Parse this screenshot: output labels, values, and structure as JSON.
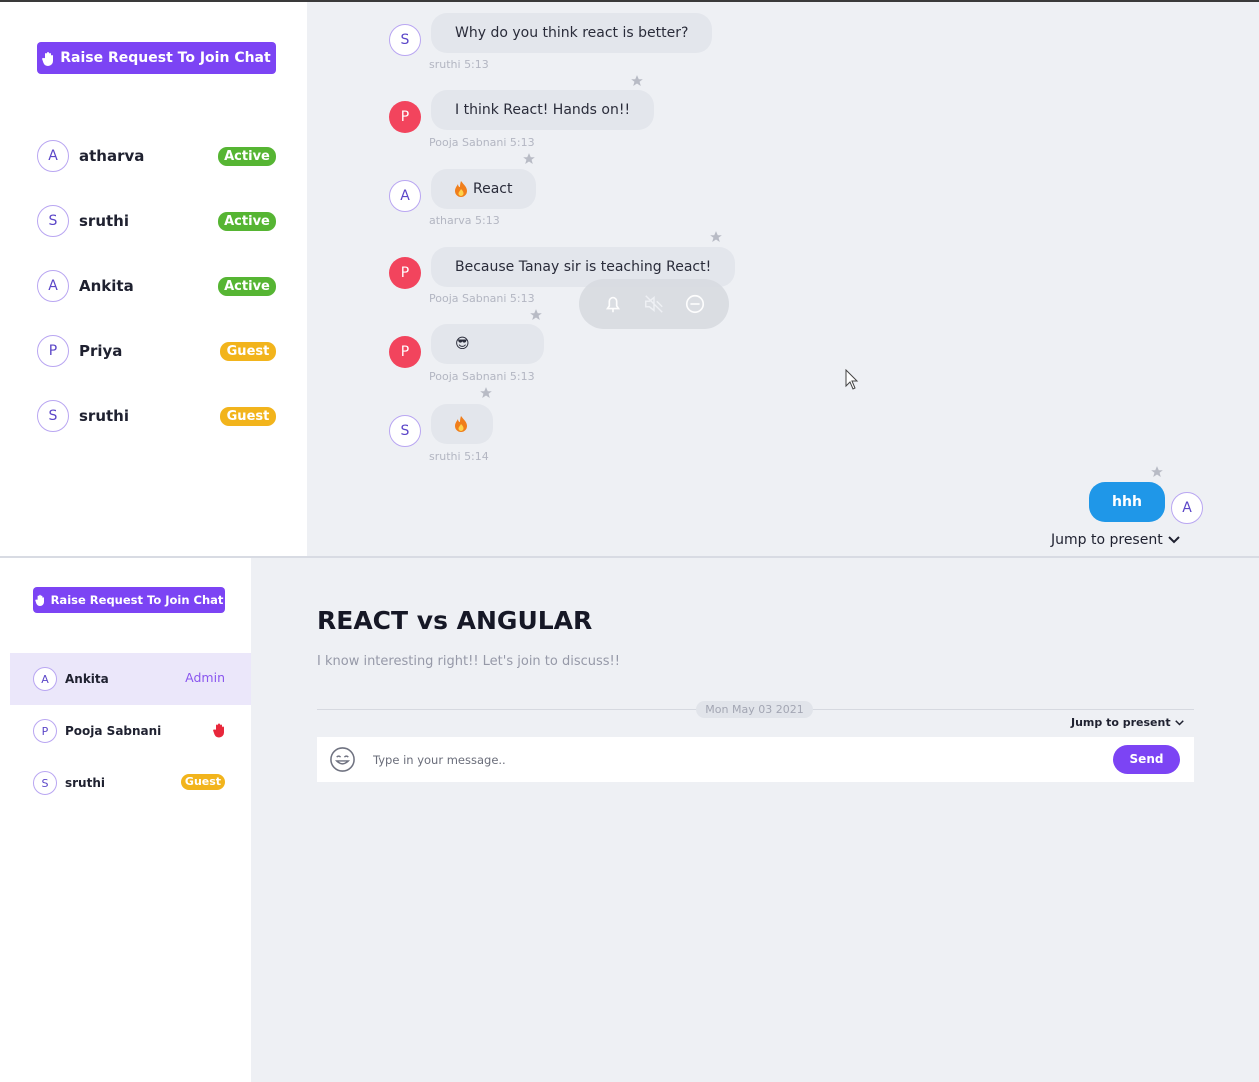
{
  "colors": {
    "accent": "#7c44f4",
    "active_badge": "#56b533",
    "guest_badge": "#f2b41c",
    "own_message": "#1f97e8",
    "chat_background": "#eef0f4",
    "red_avatar": "#f2445d"
  },
  "top_view": {
    "raise_button_label": "Raise Request To Join Chat",
    "members": [
      {
        "initial": "A",
        "name": "atharva",
        "badge": "Active"
      },
      {
        "initial": "S",
        "name": "sruthi",
        "badge": "Active"
      },
      {
        "initial": "A",
        "name": "Ankita",
        "badge": "Active"
      },
      {
        "initial": "P",
        "name": "Priya",
        "badge": "Guest"
      },
      {
        "initial": "S",
        "name": "sruthi",
        "badge": "Guest"
      }
    ],
    "messages": [
      {
        "initial": "S",
        "text": "Why do you think react is better?",
        "meta": "sruthi 5:13"
      },
      {
        "initial": "P",
        "text": "I think React! Hands on!!",
        "meta": "Pooja Sabnani 5:13"
      },
      {
        "initial": "A",
        "text": "React",
        "meta": "atharva 5:13"
      },
      {
        "initial": "P",
        "text": "Because Tanay sir is teaching React!",
        "meta": "Pooja Sabnani 5:13"
      },
      {
        "initial": "P",
        "text": "😎",
        "meta": "Pooja Sabnani 5:13"
      },
      {
        "initial": "S",
        "text": "",
        "meta": "sruthi 5:14"
      }
    ],
    "own_message": {
      "text": "hhh",
      "initial": "A"
    },
    "hover_actions": [
      "pin-icon",
      "mute-icon",
      "remove-icon"
    ],
    "jump_label": "Jump to present"
  },
  "bottom_view": {
    "raise_button_label": "Raise Request To Join Chat",
    "members": [
      {
        "initial": "A",
        "name": "Ankita",
        "role": "Admin"
      },
      {
        "initial": "P",
        "name": "Pooja Sabnani",
        "role": "raised-hand-icon"
      },
      {
        "initial": "S",
        "name": "sruthi",
        "role": "Guest"
      }
    ],
    "room_title": "REACT vs ANGULAR",
    "room_description": "I know interesting right!! Let's join to discuss!!",
    "date_label": "Mon May 03 2021",
    "jump_label": "Jump to present",
    "composer_placeholder": "Type in your message..",
    "send_label": "Send"
  }
}
